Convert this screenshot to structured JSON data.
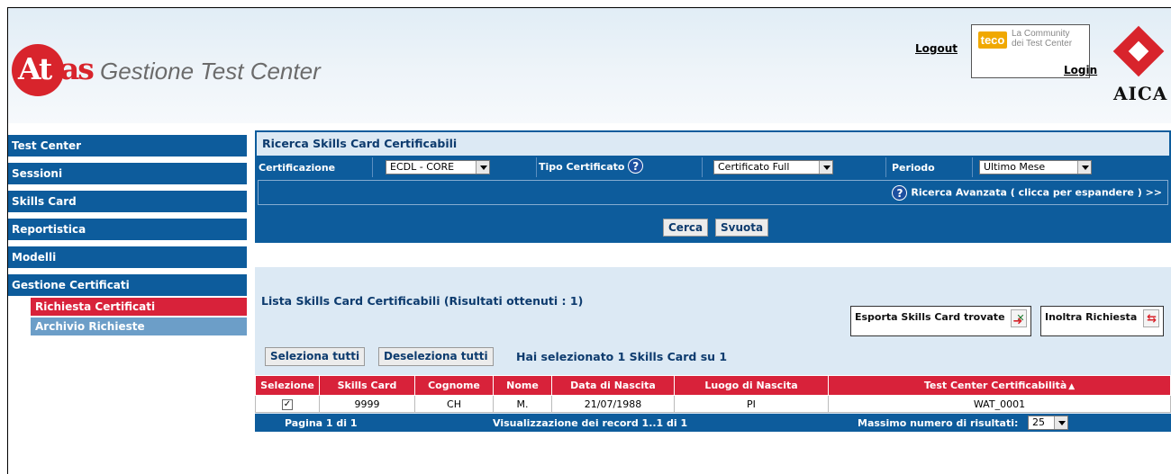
{
  "header": {
    "logo_text_main": "At",
    "logo_text_tail": "las",
    "app_title": "Gestione Test Center",
    "logout_label": "Logout",
    "teco_logo": "teco",
    "teco_line1": "La Community",
    "teco_line2": "dei Test Center",
    "login_label": "Login",
    "aica_text": "AICA"
  },
  "sidebar": {
    "items": [
      {
        "label": "Test Center"
      },
      {
        "label": "Sessioni"
      },
      {
        "label": "Skills Card"
      },
      {
        "label": "Reportistica"
      },
      {
        "label": "Modelli"
      },
      {
        "label": "Gestione Certificati"
      }
    ],
    "subitems": [
      {
        "label": "Richiesta Certificati",
        "active": true
      },
      {
        "label": "Archivio Richieste",
        "active": false
      }
    ]
  },
  "search": {
    "title": "Ricerca Skills Card Certificabili",
    "certificazione_label": "Certificazione",
    "certificazione_value": "ECDL - CORE",
    "tipo_label": "Tipo Certificato",
    "tipo_value": "Certificato Full",
    "periodo_label": "Periodo",
    "periodo_value": "Ultimo Mese",
    "advanced_label": "Ricerca Avanzata  ( clicca per espandere ) >>",
    "search_button": "Cerca",
    "clear_button": "Svuota"
  },
  "results": {
    "title": "Lista Skills Card Certificabili (Risultati ottenuti : 1)",
    "export_label": "Esporta Skills Card trovate",
    "forward_label": "Inoltra Richiesta",
    "select_all": "Seleziona tutti",
    "deselect_all": "Deseleziona tutti",
    "selection_info": "Hai selezionato 1 Skills Card su 1",
    "columns": [
      "Selezione",
      "Skills Card",
      "Cognome",
      "Nome",
      "Data di Nascita",
      "Luogo di Nascita",
      "Test Center Certificabilità"
    ],
    "rows": [
      {
        "selected": true,
        "skills_card": "9999",
        "cognome": "CH",
        "nome": "M.",
        "data_nascita": "21/07/1988",
        "luogo_nascita": "PI",
        "test_center": "WAT_0001"
      }
    ],
    "footer_pages": "Pagina 1 di 1",
    "footer_records": "Visualizzazione dei record 1..1 di 1",
    "footer_max_label": "Massimo numero di risultati:",
    "footer_max_value": "25"
  },
  "colors": {
    "primary_blue": "#0d5c9c",
    "accent_red": "#d8223a",
    "panel_light": "#dce9f4"
  }
}
